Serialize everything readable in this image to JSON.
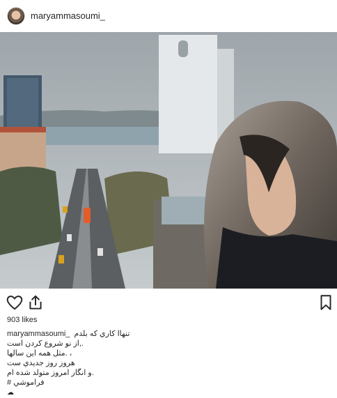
{
  "header": {
    "username": "maryammasoumi_"
  },
  "post": {
    "likes": "903 likes",
    "caption": {
      "username": "maryammasoumi_",
      "line1": "تنهاا كاري كه بلدم",
      "line2": ".,از نو شروع كردن است",
      "line3": "، .مثل همه اين سالها",
      "line4": "هروز روز جديدي ست",
      "line5": ".و انگار امروز متولد شده ام",
      "hashtag": "# فراموشي",
      "emoji": "☁"
    }
  },
  "icons": {
    "like": "heart-outline-icon",
    "share": "share-icon",
    "save": "bookmark-icon"
  },
  "colors": {
    "text": "#262626",
    "sky": "#aeb5ba",
    "water": "#8fa3ad",
    "building": "#e9ecee"
  }
}
